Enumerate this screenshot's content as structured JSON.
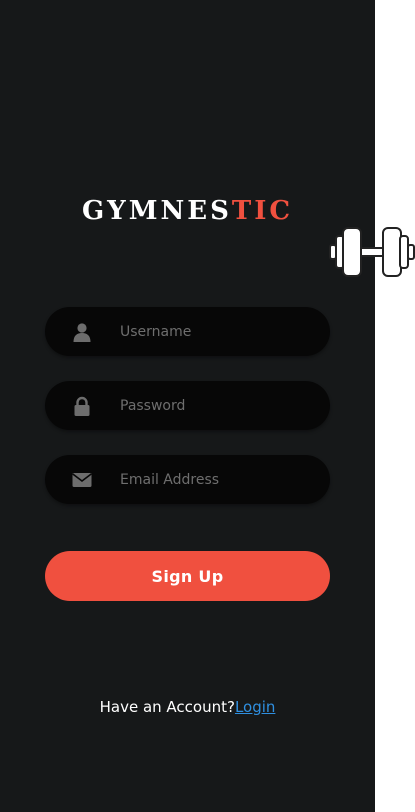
{
  "brand": {
    "name_primary": "GYMNES",
    "name_accent": "TIC",
    "accent_color": "#f0503f"
  },
  "form": {
    "username": {
      "value": "",
      "placeholder": "Username",
      "icon": "user-icon"
    },
    "password": {
      "value": "",
      "placeholder": "Password",
      "icon": "lock-icon"
    },
    "email": {
      "value": "",
      "placeholder": "Email Address",
      "icon": "envelope-icon"
    }
  },
  "signup_button": {
    "label": "Sign Up",
    "color": "#f0503f"
  },
  "footer": {
    "prompt": "Have an Account?",
    "login_link": "Login",
    "link_color": "#2f8fe0"
  },
  "decor": {
    "icon": "dumbbell-icon"
  },
  "theme": {
    "background": "#161819",
    "field_background": "#070707"
  }
}
